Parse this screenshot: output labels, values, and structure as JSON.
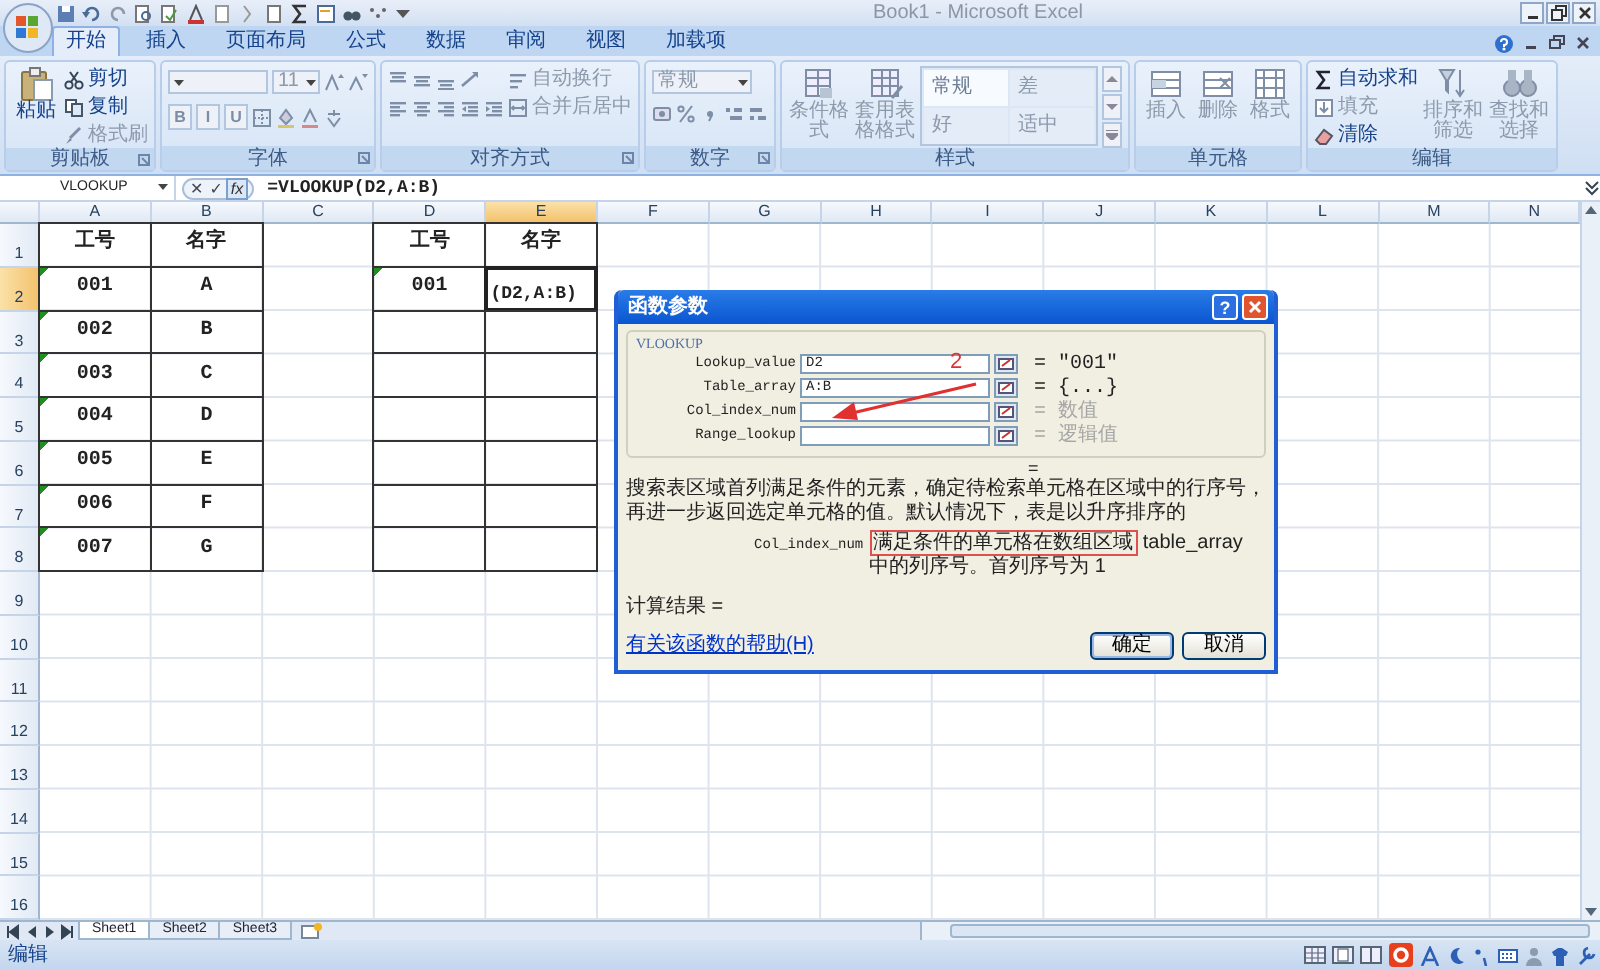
{
  "window": {
    "title": "Book1 - Microsoft Excel"
  },
  "ribbon_tabs": [
    {
      "label": "开始",
      "selected": true
    },
    {
      "label": "插入",
      "selected": false
    },
    {
      "label": "页面布局",
      "selected": false
    },
    {
      "label": "公式",
      "selected": false
    },
    {
      "label": "数据",
      "selected": false
    },
    {
      "label": "审阅",
      "selected": false
    },
    {
      "label": "视图",
      "selected": false
    },
    {
      "label": "加载项",
      "selected": false
    }
  ],
  "ribbon_groups": [
    {
      "label": "剪贴板",
      "launcher": true,
      "sections": [
        {
          "kind": "large",
          "items": [
            {
              "label": "粘贴",
              "disabled": false
            }
          ]
        },
        {
          "kind": "stack",
          "items": [
            {
              "label": "剪切",
              "disabled": false
            },
            {
              "label": "复制",
              "disabled": false
            },
            {
              "label": "格式刷",
              "disabled": true
            }
          ]
        }
      ]
    },
    {
      "label": "字体",
      "launcher": true,
      "sections": [
        {
          "kind": "rows",
          "rows": [
            [
              {
                "kind": "combo"
              },
              {
                "kind": "combo",
                "value": "11"
              },
              {
                "kind": "icon"
              },
              {
                "kind": "icon"
              }
            ],
            [
              {
                "kind": "toggle",
                "label": "B"
              },
              {
                "kind": "toggle",
                "label": "I"
              },
              {
                "kind": "toggle",
                "label": "U"
              },
              {
                "kind": "icon"
              },
              {
                "kind": "icon"
              },
              {
                "kind": "icon"
              },
              {
                "kind": "icon"
              }
            ]
          ]
        }
      ]
    },
    {
      "label": "对齐方式",
      "launcher": true,
      "sections": [
        {
          "kind": "rows",
          "rows": [
            [
              {
                "kind": "icon"
              },
              {
                "kind": "icon"
              },
              {
                "kind": "icon"
              },
              {
                "kind": "icon"
              }
            ],
            [
              {
                "kind": "icon"
              },
              {
                "kind": "icon"
              },
              {
                "kind": "icon"
              },
              {
                "kind": "icon"
              },
              {
                "kind": "icon"
              }
            ]
          ]
        },
        {
          "kind": "stack",
          "items": [
            {
              "label": "自动换行",
              "disabled": true
            },
            {
              "label": "合并后居中",
              "disabled": true
            }
          ]
        }
      ]
    },
    {
      "label": "数字",
      "launcher": true,
      "sections": [
        {
          "kind": "rows",
          "rows": [
            [
              {
                "kind": "combo",
                "value": "常规"
              }
            ],
            [
              {
                "kind": "icon"
              },
              {
                "kind": "icon"
              },
              {
                "kind": "icon"
              },
              {
                "kind": "icon"
              },
              {
                "kind": "icon"
              }
            ]
          ]
        }
      ]
    },
    {
      "label": "样式",
      "launcher": false,
      "sections": [
        {
          "kind": "large",
          "items": [
            {
              "label": "条件格式",
              "disabled": true
            },
            {
              "label": "套用表格格式",
              "disabled": true
            }
          ]
        },
        {
          "kind": "gallery",
          "items": [
            {
              "label": "常规",
              "selected": true
            },
            {
              "label": "差",
              "selected": false
            },
            {
              "label": "好",
              "selected": false
            },
            {
              "label": "适中",
              "selected": false
            }
          ]
        }
      ]
    },
    {
      "label": "单元格",
      "launcher": false,
      "sections": [
        {
          "kind": "large",
          "items": [
            {
              "label": "插入",
              "disabled": true
            },
            {
              "label": "删除",
              "disabled": true
            },
            {
              "label": "格式",
              "disabled": true
            }
          ]
        }
      ]
    },
    {
      "label": "编辑",
      "launcher": false,
      "sections": [
        {
          "kind": "stack",
          "items": [
            {
              "label": "自动求和",
              "disabled": false
            },
            {
              "label": "填充",
              "disabled": true
            },
            {
              "label": "清除",
              "disabled": false
            }
          ]
        },
        {
          "kind": "large",
          "items": [
            {
              "label": "排序和筛选",
              "disabled": true
            },
            {
              "label": "查找和选择",
              "disabled": true
            }
          ]
        }
      ]
    }
  ],
  "formula_bar": {
    "name_box": "VLOOKUP",
    "buttons": [
      "✕",
      "✓"
    ],
    "insert_function": "fx",
    "formula": "=VLOOKUP(D2,A:B)"
  },
  "columns": [
    {
      "label": "A",
      "selected": false
    },
    {
      "label": "B",
      "selected": false
    },
    {
      "label": "C",
      "selected": false
    },
    {
      "label": "D",
      "selected": false
    },
    {
      "label": "E",
      "selected": true
    },
    {
      "label": "F",
      "selected": false
    },
    {
      "label": "G",
      "selected": false
    },
    {
      "label": "H",
      "selected": false
    },
    {
      "label": "I",
      "selected": false
    },
    {
      "label": "J",
      "selected": false
    },
    {
      "label": "K",
      "selected": false
    },
    {
      "label": "L",
      "selected": false
    },
    {
      "label": "M",
      "selected": false
    },
    {
      "label": "N",
      "selected": false
    }
  ],
  "rows": [
    {
      "label": "1",
      "selected": false,
      "cells": [
        {
          "text": "工号",
          "bordered": true,
          "error_indicator": false
        },
        {
          "text": "名字",
          "bordered": true,
          "error_indicator": false
        },
        {
          "bordered": false,
          "error_indicator": false
        },
        {
          "text": "工号",
          "bordered": true,
          "error_indicator": false
        },
        {
          "text": "名字",
          "bordered": true,
          "error_indicator": false
        }
      ]
    },
    {
      "label": "2",
      "selected": true,
      "cells": [
        {
          "text": "001",
          "bordered": true,
          "error_indicator": true
        },
        {
          "text": "A",
          "bordered": true,
          "error_indicator": false
        },
        {
          "bordered": false,
          "error_indicator": false
        },
        {
          "text": "001",
          "bordered": true,
          "error_indicator": true
        },
        {
          "text": "(D2,A:B)",
          "bordered": true,
          "error_indicator": false
        }
      ]
    },
    {
      "label": "3",
      "selected": false,
      "cells": [
        {
          "text": "002",
          "bordered": true,
          "error_indicator": true
        },
        {
          "text": "B",
          "bordered": true,
          "error_indicator": false
        },
        {
          "bordered": false,
          "error_indicator": false
        },
        {
          "bordered": true,
          "error_indicator": false
        },
        {
          "bordered": true,
          "error_indicator": false
        }
      ]
    },
    {
      "label": "4",
      "selected": false,
      "cells": [
        {
          "text": "003",
          "bordered": true,
          "error_indicator": true
        },
        {
          "text": "C",
          "bordered": true,
          "error_indicator": false
        },
        {
          "bordered": false,
          "error_indicator": false
        },
        {
          "bordered": true,
          "error_indicator": false
        },
        {
          "bordered": true,
          "error_indicator": false
        }
      ]
    },
    {
      "label": "5",
      "selected": false,
      "cells": [
        {
          "text": "004",
          "bordered": true,
          "error_indicator": true
        },
        {
          "text": "D",
          "bordered": true,
          "error_indicator": false
        },
        {
          "bordered": false,
          "error_indicator": false
        },
        {
          "bordered": true,
          "error_indicator": false
        },
        {
          "bordered": true,
          "error_indicator": false
        }
      ]
    },
    {
      "label": "6",
      "selected": false,
      "cells": [
        {
          "text": "005",
          "bordered": true,
          "error_indicator": true
        },
        {
          "text": "E",
          "bordered": true,
          "error_indicator": false
        },
        {
          "bordered": false,
          "error_indicator": false
        },
        {
          "bordered": true,
          "error_indicator": false
        },
        {
          "bordered": true,
          "error_indicator": false
        }
      ]
    },
    {
      "label": "7",
      "selected": false,
      "cells": [
        {
          "text": "006",
          "bordered": true,
          "error_indicator": true
        },
        {
          "text": "F",
          "bordered": true,
          "error_indicator": false
        },
        {
          "bordered": false,
          "error_indicator": false
        },
        {
          "bordered": true,
          "error_indicator": false
        },
        {
          "bordered": true,
          "error_indicator": false
        }
      ]
    },
    {
      "label": "8",
      "selected": false,
      "cells": [
        {
          "text": "007",
          "bordered": true,
          "error_indicator": true
        },
        {
          "text": "G",
          "bordered": true,
          "error_indicator": false
        },
        {
          "bordered": false,
          "error_indicator": false
        },
        {
          "bordered": true,
          "error_indicator": false
        },
        {
          "bordered": true,
          "error_indicator": false
        }
      ]
    },
    {
      "label": "9",
      "selected": false
    },
    {
      "label": "10",
      "selected": false
    },
    {
      "label": "11",
      "selected": false
    },
    {
      "label": "12",
      "selected": false
    },
    {
      "label": "13",
      "selected": false
    },
    {
      "label": "14",
      "selected": false
    },
    {
      "label": "15",
      "selected": false
    },
    {
      "label": "16",
      "selected": false
    }
  ],
  "dialog": {
    "title": "函数参数",
    "help_button": "?",
    "function_name": "VLOOKUP",
    "arguments": [
      {
        "name": "Lookup_value",
        "value": "D2",
        "result": "= \"001\"",
        "kind": "value"
      },
      {
        "name": "Table_array",
        "value": "A:B",
        "result": "= {...}",
        "kind": "value"
      },
      {
        "name": "Col_index_num",
        "result": "= 数值",
        "kind": "hint"
      },
      {
        "name": "Range_lookup",
        "result": "= 逻辑值",
        "kind": "hint"
      }
    ],
    "formula_result": "=",
    "description": "搜索表区域首列满足条件的元素，确定待检索单元格在区域中的行序号，再进一步返回选定单元格的值。默认情况下，表是以升序排序的",
    "argument_help": {
      "name": "Col_index_num",
      "highlight": "满足条件的单元格在数组区域",
      "text": "table_array 中的列序号。首列序号为 1"
    },
    "calc_result": "计算结果 =",
    "help_link": "有关该函数的帮助(H)",
    "buttons": [
      {
        "label": "确定",
        "default": true
      },
      {
        "label": "取消",
        "default": false
      }
    ],
    "annotation": {
      "label": "2"
    }
  },
  "sheet_tabs": [
    {
      "label": "Sheet1",
      "selected": true
    },
    {
      "label": "Sheet2",
      "selected": false
    },
    {
      "label": "Sheet3",
      "selected": false
    }
  ],
  "status_bar": {
    "mode": "编辑"
  }
}
